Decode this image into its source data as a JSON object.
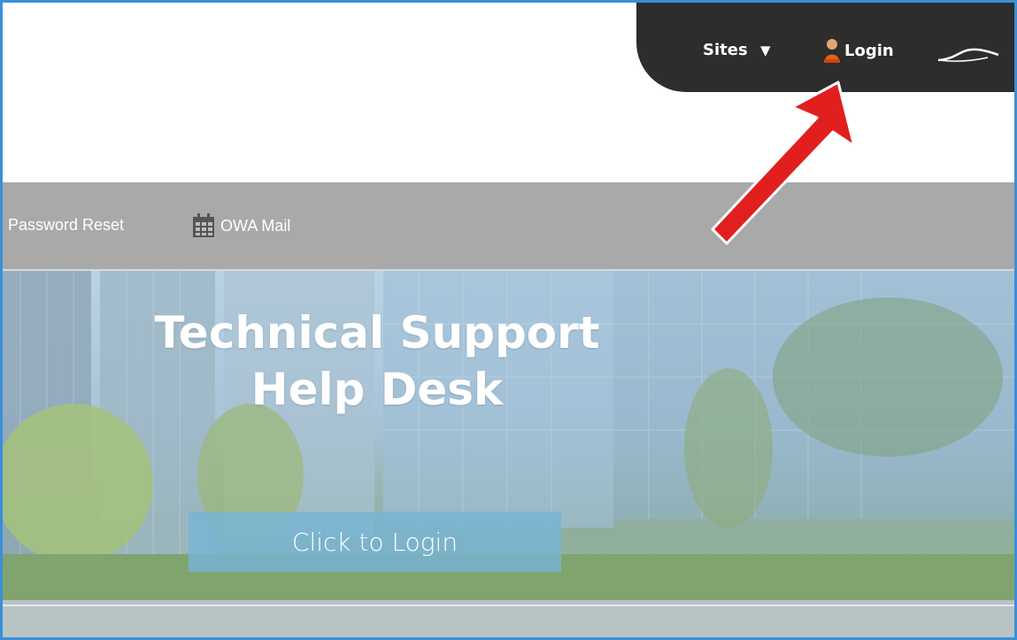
{
  "nav": {
    "sites_label": "Sites",
    "sites_caret": "▼",
    "login_label": "Login"
  },
  "links": {
    "password_reset": "Password Reset",
    "owa_mail": "OWA Mail"
  },
  "hero": {
    "title_line1": "Technical Support",
    "title_line2": "Help Desk",
    "cta_label": "Click to Login"
  },
  "colors": {
    "frame_border": "#3a8fd9",
    "topnav_bg": "#2d2d2d",
    "linkbar_bg": "#a9a9a9",
    "arrow": "#e21f1f",
    "cta_bg": "#78b4d2"
  },
  "icons": [
    "user-icon",
    "calendar-icon",
    "logo-swoosh-icon",
    "red-arrow-annotation"
  ]
}
